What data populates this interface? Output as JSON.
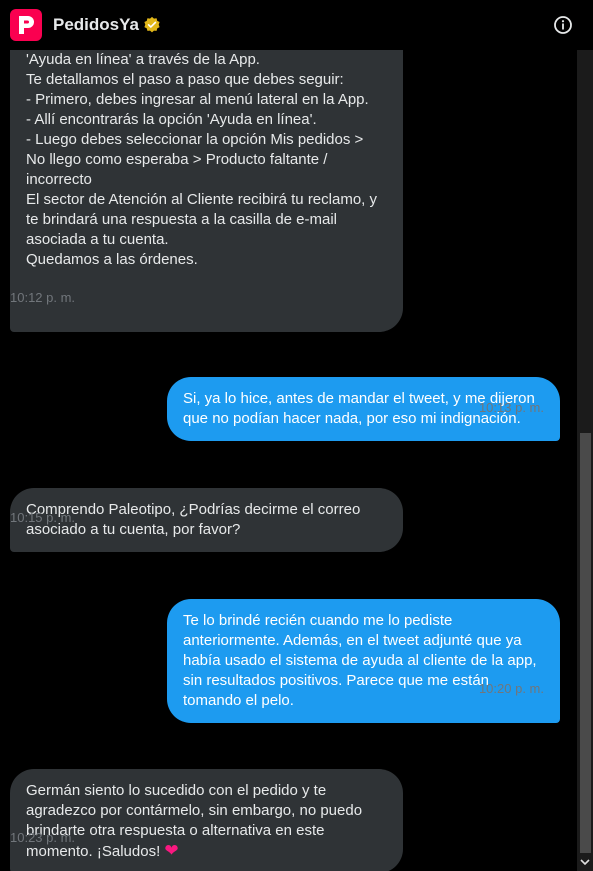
{
  "header": {
    "title": "PedidosYa",
    "logo_letter": "P",
    "brand_color": "#fa0050",
    "verified_color": "#e2b719",
    "info_icon": "info-icon"
  },
  "messages": [
    {
      "direction": "in",
      "text": "'Ayuda en línea' a través de la App.\nTe detallamos el paso a paso que debes seguir:\n- Primero, debes ingresar al menú lateral en la App.\n- Allí encontrarás la opción 'Ayuda en línea'.\n- Luego debes seleccionar la opción Mis pedidos >\nNo llego como esperaba > Producto faltante /\nincorrecto\nEl sector de Atención al Cliente recibirá tu reclamo, y\nte brindará una respuesta a la casilla de e-mail\nasociada a tu cuenta.\nQuedamos a las órdenes.",
      "time": "10:12 p. m."
    },
    {
      "direction": "out",
      "text": "Si, ya lo hice, antes de mandar el tweet, y me dijeron\nque no podían hacer nada, por eso mi indignación.",
      "time": "10:13 p. m."
    },
    {
      "direction": "in",
      "text": "Comprendo Paleotipo, ¿Podrías decirme el correo\nasociado a tu cuenta, por favor?",
      "time": "10:15 p. m."
    },
    {
      "direction": "out",
      "text": "Te lo brindé recién cuando me lo pediste\nanteriormente. Además,  en el tweet adjunté que ya\nhabía usado el sistema de ayuda al cliente de la app,\nsin resultados positivos. Parece que me están\ntomando el pelo.",
      "time": "10:20 p. m."
    },
    {
      "direction": "in",
      "text": "Germán siento lo sucedido con el pedido y te\nagradezco por contármelo, sin embargo, no puedo\nbrindarte otra respuesta o alternativa en este\nmomento.  ¡Saludos! ",
      "emoji": "❤",
      "time": "10:23 p. m."
    }
  ],
  "colors": {
    "incoming_bubble": "#2f3336",
    "outgoing_bubble": "#1d9bf0",
    "timestamp": "#71767b"
  }
}
